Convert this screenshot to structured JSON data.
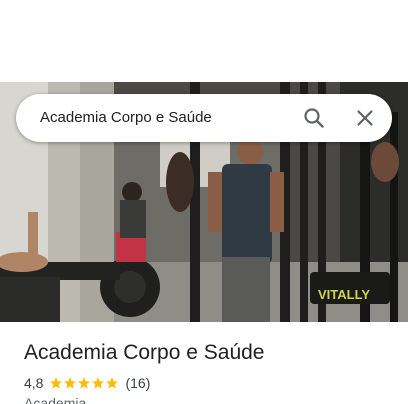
{
  "search": {
    "query": "Academia Corpo e Saúde",
    "search_icon": "search-icon",
    "close_icon": "close-icon"
  },
  "photo": {
    "sign_text": "VITALLY"
  },
  "place": {
    "title": "Academia Corpo e Saúde",
    "rating": "4,8",
    "stars_filled": 5,
    "stars_total": 5,
    "review_count": "(16)",
    "category": "Academia",
    "star_color": "#fbbc04"
  }
}
